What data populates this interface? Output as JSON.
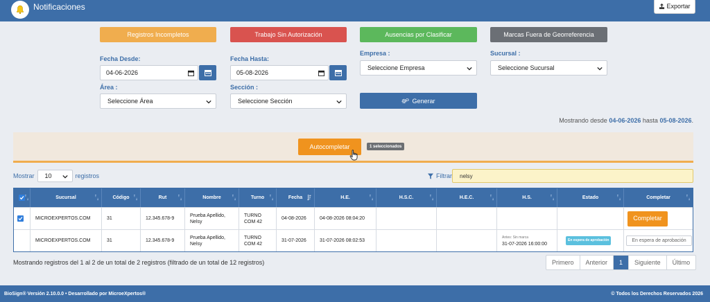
{
  "header": {
    "title": "Notificaciones",
    "export_label": "Exportar"
  },
  "categories": [
    {
      "label": "Registros Incompletos",
      "color": "#f0ad4e"
    },
    {
      "label": "Trabajo Sin Autorización",
      "color": "#d9534f"
    },
    {
      "label": "Ausencias por Clasificar",
      "color": "#5cb85c"
    },
    {
      "label": "Marcas Fuera de Georreferencia",
      "color": "#6b6f75"
    }
  ],
  "filters": {
    "fecha_desde_label": "Fecha Desde:",
    "fecha_desde_value": "04-06-2026",
    "fecha_hasta_label": "Fecha Hasta:",
    "fecha_hasta_value": "05-08-2026",
    "empresa_label": "Empresa :",
    "empresa_value": "Seleccione Empresa",
    "sucursal_label": "Sucursal :",
    "sucursal_value": "Seleccione Sucursal",
    "area_label": "Área :",
    "area_value": "Seleccione Área",
    "seccion_label": "Sección :",
    "seccion_value": "Seleccione Sección",
    "generar_label": "Generar"
  },
  "range": {
    "prefix": "Mostrando desde",
    "from": "04-06-2026",
    "mid": "hasta",
    "to": "05-08-2026",
    "suffix": "."
  },
  "autocomplete": {
    "button_label": "Autocompletar",
    "selected_badge": "1 seleccionados"
  },
  "list_controls": {
    "show_label": "Mostrar",
    "show_value": "10",
    "records_label": "registros",
    "filter_label": "Filtrar:",
    "filter_value": "nelsy"
  },
  "table": {
    "columns": [
      "",
      "Sucursal",
      "Código",
      "Rut",
      "Nombre",
      "Turno",
      "Fecha",
      "H.E.",
      "H.S.C.",
      "H.E.C.",
      "H.S.",
      "Estado",
      "Completar"
    ],
    "rows": [
      {
        "checked": true,
        "sucursal": "MICROEXPERTOS.COM",
        "codigo": "31",
        "rut": "12.345.678-9",
        "nombre_1": "Prueba Apellido,",
        "nombre_2": "Nelsy",
        "turno_1": "TURNO",
        "turno_2": "COM 42",
        "fecha": "04-08-2026",
        "he": "04-08-2026 08:04:20",
        "hsc": "",
        "hec": "",
        "hs_note": "",
        "hs": "",
        "estado": "",
        "completar": "Completar"
      },
      {
        "checked": false,
        "sucursal": "MICROEXPERTOS.COM",
        "codigo": "31",
        "rut": "12.345.678-9",
        "nombre_1": "Prueba Apellido,",
        "nombre_2": "Nelsy",
        "turno_1": "TURNO",
        "turno_2": "COM 42",
        "fecha": "31-07-2026",
        "he": "31-07-2026 08:02:53",
        "hsc": "",
        "hec": "",
        "hs_note": "Antes: Sin marca",
        "hs": "31-07-2026 16:00:00",
        "estado": "En espera de aprobación",
        "completar": "En espera de aprobación"
      }
    ]
  },
  "summary": "Mostrando registros del 1 al 2 de un total de 2 registros (filtrado de un total de 12 registros)",
  "pagination": {
    "first": "Primero",
    "prev": "Anterior",
    "current": "1",
    "next": "Siguiente",
    "last": "Último"
  },
  "footer": {
    "left": "BioSign® Versión 2.10.0.0 • Desarrollado por MicroeXpertos®",
    "right": "© Todos los Derechos Reservados 2026"
  }
}
